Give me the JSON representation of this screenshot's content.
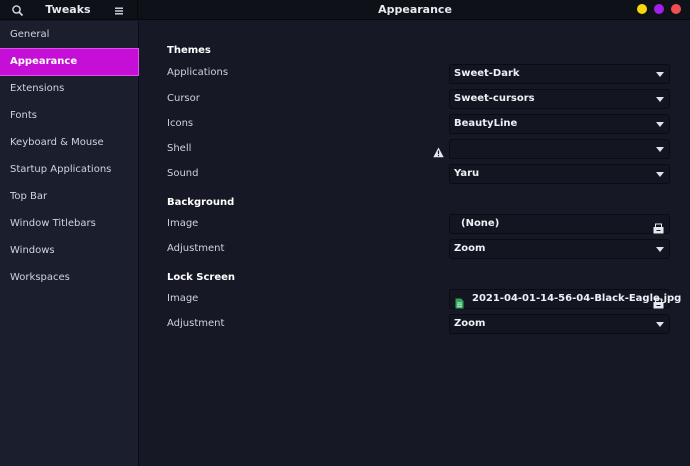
{
  "header": {
    "app_title": "Tweaks",
    "page_title": "Appearance",
    "window_buttons": [
      {
        "name": "minimize",
        "color": "#f5d90a"
      },
      {
        "name": "maximize",
        "color": "#a020f0"
      },
      {
        "name": "close",
        "color": "#f25050"
      }
    ]
  },
  "sidebar": {
    "active_color": "#c60fd6",
    "items": [
      {
        "label": "General"
      },
      {
        "label": "Appearance",
        "active": true
      },
      {
        "label": "Extensions"
      },
      {
        "label": "Fonts"
      },
      {
        "label": "Keyboard & Mouse"
      },
      {
        "label": "Startup Applications"
      },
      {
        "label": "Top Bar"
      },
      {
        "label": "Window Titlebars"
      },
      {
        "label": "Windows"
      },
      {
        "label": "Workspaces"
      }
    ]
  },
  "themes": {
    "heading": "Themes",
    "applications": {
      "label": "Applications",
      "value": "Sweet-Dark"
    },
    "cursor": {
      "label": "Cursor",
      "value": "Sweet-cursors"
    },
    "icons": {
      "label": "Icons",
      "value": "BeautyLine"
    },
    "shell": {
      "label": "Shell",
      "value": "",
      "warning_icon": "warning-icon"
    },
    "sound": {
      "label": "Sound",
      "value": "Yaru"
    }
  },
  "background": {
    "heading": "Background",
    "image": {
      "label": "Image",
      "value": "(None)"
    },
    "adjustment": {
      "label": "Adjustment",
      "value": "Zoom"
    }
  },
  "lock_screen": {
    "heading": "Lock Screen",
    "image": {
      "label": "Image",
      "value": "2021-04-01-14-56-04-Black-Eagle.jpg"
    },
    "adjustment": {
      "label": "Adjustment",
      "value": "Zoom"
    }
  }
}
